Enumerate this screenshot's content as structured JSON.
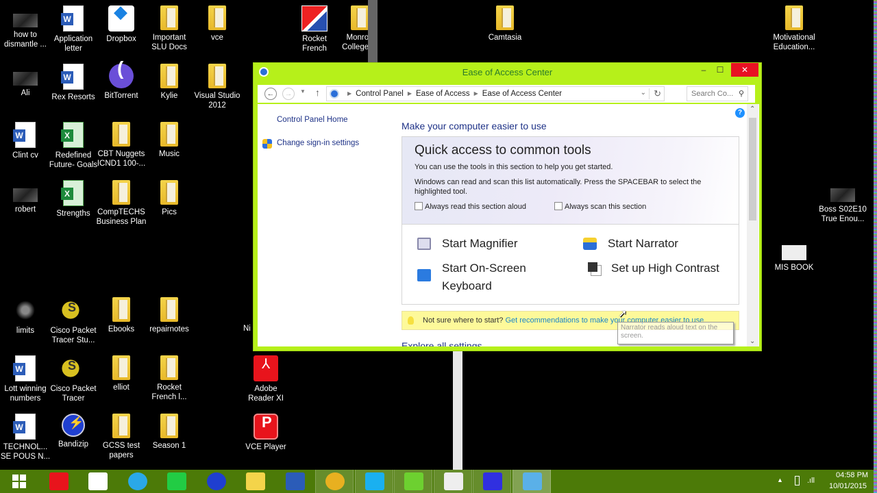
{
  "desktop": {
    "icons": [
      {
        "label": "how to dismantle ...",
        "type": "thumb"
      },
      {
        "label": "Application letter",
        "type": "word"
      },
      {
        "label": "Dropbox",
        "type": "dropbox"
      },
      {
        "label": "Important SLU Docs",
        "type": "folder"
      },
      {
        "label": "vce",
        "type": "folder"
      },
      {
        "label": "Rocket French",
        "type": "rocket"
      },
      {
        "label": "Monroe College ...",
        "type": "folder"
      },
      {
        "label": "Camtasia",
        "type": "folder"
      },
      {
        "label": "Motivational Education...",
        "type": "folder"
      },
      {
        "label": "Ali",
        "type": "thumb"
      },
      {
        "label": "Rex Resorts",
        "type": "word"
      },
      {
        "label": "BitTorrent",
        "type": "bittorrent"
      },
      {
        "label": "Kylie",
        "type": "folder"
      },
      {
        "label": "Visual Studio 2012",
        "type": "folder"
      },
      {
        "label": "Clint cv",
        "type": "word"
      },
      {
        "label": "Redefined Future- Goals",
        "type": "excel"
      },
      {
        "label": "CBT Nuggets ICND1 100-...",
        "type": "folder"
      },
      {
        "label": "Music",
        "type": "folder"
      },
      {
        "label": "robert",
        "type": "thumb"
      },
      {
        "label": "Strengths",
        "type": "excel"
      },
      {
        "label": "CompTECHS Business Plan",
        "type": "folder"
      },
      {
        "label": "Pics",
        "type": "folder"
      },
      {
        "label": "Boss S02E10 True Enou...",
        "type": "thumb"
      },
      {
        "label": "MIS BOOK",
        "type": "book"
      },
      {
        "label": "limits",
        "type": "limits"
      },
      {
        "label": "Cisco Packet Tracer Stu...",
        "type": "cisco"
      },
      {
        "label": "Ebooks",
        "type": "folder"
      },
      {
        "label": "repairnotes",
        "type": "folder"
      },
      {
        "label": "Lott winning numbers",
        "type": "word"
      },
      {
        "label": "Cisco Packet Tracer",
        "type": "cisco"
      },
      {
        "label": "elliot",
        "type": "folder"
      },
      {
        "label": "Rocket French l...",
        "type": "folder"
      },
      {
        "label": "Adobe Reader XI",
        "type": "red"
      },
      {
        "label": "TECHNOL... SE POUS N...",
        "type": "word"
      },
      {
        "label": "Bandizip",
        "type": "bandizip"
      },
      {
        "label": "GCSS test papers",
        "type": "folder"
      },
      {
        "label": "Season 1",
        "type": "folder"
      },
      {
        "label": "VCE Player",
        "type": "vce"
      }
    ],
    "partial_label": "Ni"
  },
  "window": {
    "title": "Ease of Access Center",
    "controls": {
      "minimize": "–",
      "maximize": "☐",
      "close": "✕"
    },
    "address": {
      "crumbs": [
        "Control Panel",
        "Ease of Access",
        "Ease of Access Center"
      ],
      "search_placeholder": "Search Co..."
    },
    "left_pane": {
      "home_link": "Control Panel Home",
      "signin_link": "Change sign-in settings"
    },
    "main": {
      "heading": "Make your computer easier to use",
      "quick_access": {
        "title": "Quick access to common tools",
        "intro": "You can use the tools in this section to help you get started.",
        "scan_text": "Windows can read and scan this list automatically.  Press the SPACEBAR to select the highlighted tool.",
        "checkbox_read": "Always read this section aloud",
        "checkbox_scan": "Always scan this section",
        "checkbox_read_checked": false,
        "checkbox_scan_checked": false
      },
      "tools": {
        "magnifier": "Start Magnifier",
        "narrator": "Start Narrator",
        "keyboard": "Start On-Screen Keyboard",
        "contrast": "Set up High Contrast"
      },
      "tooltip": "Narrator reads aloud text on the screen.",
      "tip": {
        "prefix": "Not sure where to start?",
        "link": "Get recommendations to make your computer easier to use"
      },
      "explore": "Explore all settings"
    }
  },
  "taskbar": {
    "apps": [
      {
        "name": "start",
        "color": ""
      },
      {
        "name": "adobe-reader",
        "color": "#e8141c"
      },
      {
        "name": "amazon",
        "color": "#ffffff"
      },
      {
        "name": "internet-explorer",
        "color": "#2aa8e8"
      },
      {
        "name": "camtasia-recorder",
        "color": "#22cc44"
      },
      {
        "name": "bandizip",
        "color": "#1f3fd0"
      },
      {
        "name": "file-explorer",
        "color": "#f4d44a"
      },
      {
        "name": "word",
        "color": "#2b5cb8"
      },
      {
        "name": "chrome",
        "color": "#e8b020"
      },
      {
        "name": "skype",
        "color": "#1ab0f0"
      },
      {
        "name": "camtasia-studio",
        "color": "#6dd030"
      },
      {
        "name": "camtasia",
        "color": "#eeeeee"
      },
      {
        "name": "settings",
        "color": "#3030e0"
      },
      {
        "name": "control-panel",
        "color": "#5ab0e8"
      }
    ],
    "clock": {
      "time": "04:58 PM",
      "date": "10/01/2015"
    }
  }
}
